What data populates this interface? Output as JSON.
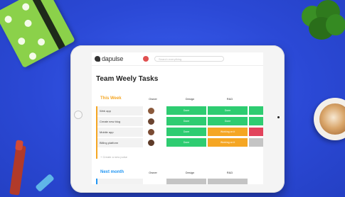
{
  "app": {
    "logo": "dapulse",
    "search_placeholder": "Search everything"
  },
  "board": {
    "title": "Team Weely Tasks",
    "columns": [
      "Owner",
      "Design",
      "R&D"
    ],
    "groups": [
      {
        "title": "This Week",
        "color": "#f5a623",
        "rows": [
          {
            "name": "Web app",
            "design": "Done",
            "rd": "Done"
          },
          {
            "name": "Create new blog",
            "design": "Done",
            "rd": "Done"
          },
          {
            "name": "Mobile app",
            "design": "Done",
            "rd": "Working on it"
          },
          {
            "name": "Billing platform",
            "design": "Done",
            "rd": "Working on it"
          }
        ],
        "add_label": "+ Create a new pulse"
      },
      {
        "title": "Next month",
        "color": "#2196f3"
      }
    ]
  },
  "colors": {
    "done": "#2ecc71",
    "working": "#f5a623",
    "stuck": "#e2445c",
    "background": "#2f4fd8"
  }
}
